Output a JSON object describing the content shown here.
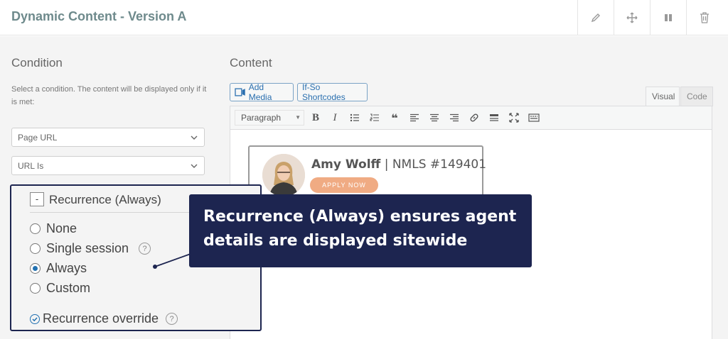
{
  "header": {
    "title": "Dynamic Content - Version A",
    "tools": [
      {
        "name": "pencil-icon"
      },
      {
        "name": "move-icon"
      },
      {
        "name": "pause-icon"
      },
      {
        "name": "trash-icon"
      }
    ]
  },
  "condition": {
    "heading": "Condition",
    "help": "Select a condition. The content will be displayed only if it is met:",
    "select_type": "Page URL",
    "select_match": "URL Is"
  },
  "recurrence": {
    "toggle_symbol": "-",
    "title": "Recurrence (Always)",
    "options": [
      {
        "label": "None",
        "selected": false
      },
      {
        "label": "Single session",
        "selected": false,
        "help": "?"
      },
      {
        "label": "Always",
        "selected": true
      },
      {
        "label": "Custom",
        "selected": false
      }
    ],
    "override_label": "Recurrence override",
    "override_checked": true,
    "override_help": "?"
  },
  "content": {
    "heading": "Content",
    "add_media": "Add Media",
    "shortcodes": "If-So Shortcodes",
    "tab_visual": "Visual",
    "tab_code": "Code",
    "paragraph": "Paragraph",
    "toolbar_icons": [
      "bold-icon",
      "italic-icon",
      "bullet-list-icon",
      "numbered-list-icon",
      "blockquote-icon",
      "align-left-icon",
      "align-center-icon",
      "align-right-icon",
      "link-icon",
      "horizontal-rule-icon",
      "fullscreen-icon",
      "toolbar-toggle-icon"
    ]
  },
  "card": {
    "agent_name": "Amy Wolff",
    "separator": "|",
    "nmls": "NMLS #149401",
    "apply": "APPLY NOW"
  },
  "callout": {
    "text": "Recurrence (Always) ensures agent details are displayed sitewide"
  },
  "colors": {
    "navy": "#1d2550",
    "accent_blue": "#2271b1",
    "apply_orange": "#f0ab83",
    "title_teal": "#6e8a8c"
  }
}
